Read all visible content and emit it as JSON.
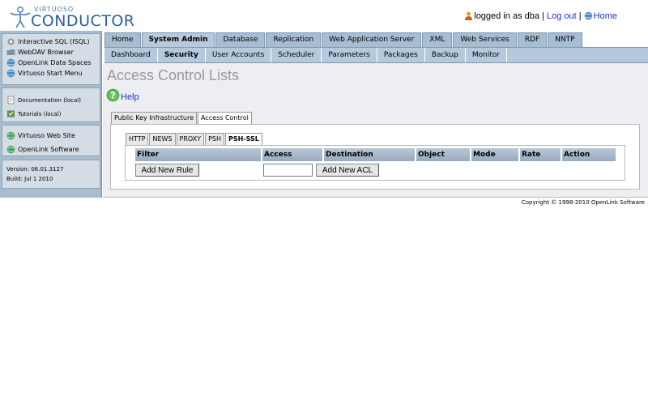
{
  "header": {
    "logo_small": "VIRTUOSO",
    "logo_big": "CONDUCTOR",
    "logged_in_text": "logged in as dba |",
    "logout_label": "Log out",
    "separator": "|",
    "home_label": "Home"
  },
  "sidebar": {
    "group1": [
      {
        "label": "Interactive SQL (ISQL)",
        "icon": "gear-icon"
      },
      {
        "label": "WebDAV Browser",
        "icon": "folder-icon"
      },
      {
        "label": "OpenLink Data Spaces",
        "icon": "globe-icon"
      },
      {
        "label": "Virtuoso Start Menu",
        "icon": "globe-icon"
      }
    ],
    "group2": [
      {
        "label": "Documentation (local)",
        "icon": "document-icon"
      },
      {
        "label": "Tutorials (local)",
        "icon": "tutorial-icon"
      }
    ],
    "group3": [
      {
        "label": "Virtuoso Web Site",
        "icon": "globe-icon"
      },
      {
        "label": "OpenLink Software",
        "icon": "globe-icon"
      }
    ],
    "version": "Version: 06.01.3127",
    "build": "Build: Jul 1 2010"
  },
  "nav1": [
    "Home",
    "System Admin",
    "Database",
    "Replication",
    "Web Application Server",
    "XML",
    "Web Services",
    "RDF",
    "NNTP"
  ],
  "nav1_active": "System Admin",
  "nav2": [
    "Dashboard",
    "Security",
    "User Accounts",
    "Scheduler",
    "Parameters",
    "Packages",
    "Backup",
    "Monitor"
  ],
  "nav2_active": "Security",
  "page": {
    "title": "Access Control Lists",
    "help_label": "Help",
    "outer_tabs": [
      "Public Key Infrastructure",
      "Access Control"
    ],
    "outer_active": "Access Control",
    "inner_tabs": [
      "HTTP",
      "NEWS",
      "PROXY",
      "PSH",
      "PSH-SSL"
    ],
    "inner_active": "PSH-SSL"
  },
  "table": {
    "columns": [
      "Filter",
      "Access",
      "Destination",
      "Object",
      "Mode",
      "Rate",
      "Action"
    ],
    "add_rule_label": "Add New Rule",
    "access_value": "",
    "add_acl_label": "Add New ACL"
  },
  "footer": {
    "copyright": "Copyright © 1998-2010 OpenLink Software"
  },
  "colors": {
    "nav_blue": "#a7bdd1",
    "sidebar_blue": "#a9bccd",
    "link_blue": "#1a33c7",
    "title_gray": "#999999"
  }
}
